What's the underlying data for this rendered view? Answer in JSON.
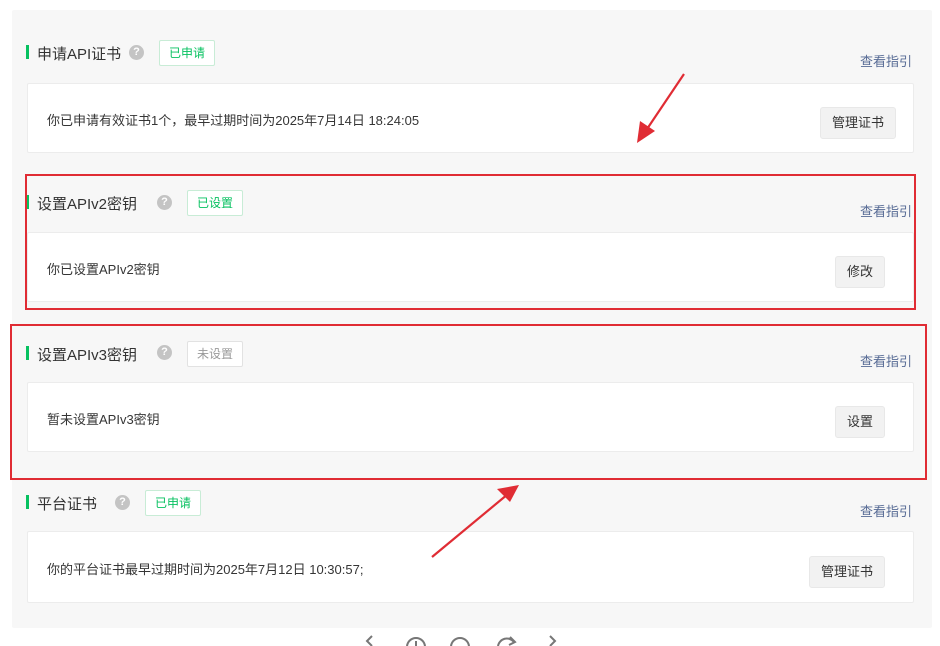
{
  "guide_label": "查看指引",
  "sections": [
    {
      "title": "申请API证书",
      "badge": "已申请",
      "badge_style": "green",
      "desc": "你已申请有效证书1个，最早过期时间为2025年7月14日 18:24:05",
      "button": "管理证书"
    },
    {
      "title": "设置APIv2密钥",
      "badge": "已设置",
      "badge_style": "green",
      "desc": "你已设置APIv2密钥",
      "button": "修改"
    },
    {
      "title": "设置APIv3密钥",
      "badge": "未设置",
      "badge_style": "gray",
      "desc": "暂未设置APIv3密钥",
      "button": "设置"
    },
    {
      "title": "平台证书",
      "badge": "已申请",
      "badge_style": "green",
      "desc": "你的平台证书最早过期时间为2025年7月12日 10:30:57;",
      "button": "管理证书"
    }
  ],
  "colors": {
    "accent_green": "#07c160",
    "link_blue": "#576b95",
    "annotation_red": "#e02c34"
  },
  "help_icon_glyph": "?",
  "icons": [
    "help-icon",
    "chevron-left-icon",
    "zoom-in-icon",
    "zoom-out-icon",
    "rotate-icon",
    "chevron-right-icon"
  ]
}
